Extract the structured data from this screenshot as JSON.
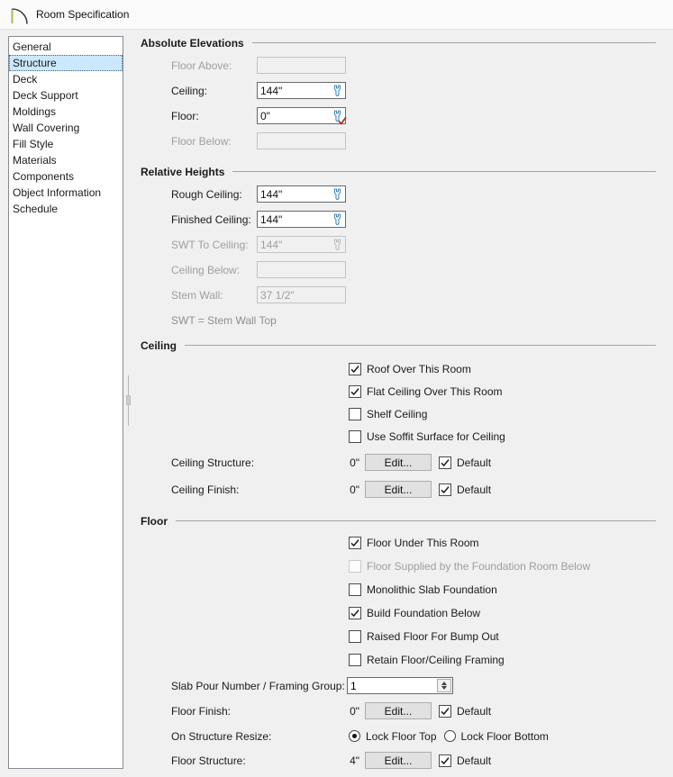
{
  "window": {
    "title": "Room Specification"
  },
  "icons": {
    "title_icon": "room-arc-icon",
    "wrench_icon": "wrench-icon",
    "modified_icon": "red-check-icon",
    "stepper_icon": "up-down-arrow-icons"
  },
  "colors": {
    "selection_bg": "#cce8ff",
    "wrench_blue": "#2f7cb5",
    "modified_red": "#b02f23",
    "panel_bg": "#f0f0f0",
    "button_bg": "#e1e1e1"
  },
  "sidebar": {
    "items": [
      {
        "label": "General",
        "selected": false
      },
      {
        "label": "Structure",
        "selected": true
      },
      {
        "label": "Deck",
        "selected": false
      },
      {
        "label": "Deck Support",
        "selected": false
      },
      {
        "label": "Moldings",
        "selected": false
      },
      {
        "label": "Wall Covering",
        "selected": false
      },
      {
        "label": "Fill Style",
        "selected": false
      },
      {
        "label": "Materials",
        "selected": false
      },
      {
        "label": "Components",
        "selected": false
      },
      {
        "label": "Object Information",
        "selected": false
      },
      {
        "label": "Schedule",
        "selected": false
      }
    ]
  },
  "sections": {
    "absolute_elevations": {
      "title": "Absolute Elevations",
      "rows": [
        {
          "label": "Floor Above:",
          "value": "",
          "disabled": true,
          "wrench": false,
          "modified": false
        },
        {
          "label": "Ceiling:",
          "value": "144\"",
          "disabled": false,
          "wrench": true,
          "modified": false
        },
        {
          "label": "Floor:",
          "value": "0\"",
          "disabled": false,
          "wrench": true,
          "modified": true
        },
        {
          "label": "Floor Below:",
          "value": "",
          "disabled": true,
          "wrench": false,
          "modified": false
        }
      ]
    },
    "relative_heights": {
      "title": "Relative Heights",
      "rows": [
        {
          "label": "Rough Ceiling:",
          "value": "144\"",
          "disabled": false,
          "wrench": true
        },
        {
          "label": "Finished Ceiling:",
          "value": "144\"",
          "disabled": false,
          "wrench": true
        },
        {
          "label": "SWT To Ceiling:",
          "value": "144\"",
          "disabled": true,
          "wrench": true
        },
        {
          "label": "Ceiling Below:",
          "value": "",
          "disabled": true,
          "wrench": false
        },
        {
          "label": "Stem Wall:",
          "value": "37 1/2\"",
          "disabled": true,
          "wrench": false
        }
      ],
      "note": "SWT = Stem Wall Top"
    },
    "ceiling": {
      "title": "Ceiling",
      "checkboxes": [
        {
          "label": "Roof Over This Room",
          "checked": true,
          "disabled": false
        },
        {
          "label": "Flat Ceiling Over This Room",
          "checked": true,
          "disabled": false
        },
        {
          "label": "Shelf Ceiling",
          "checked": false,
          "disabled": false
        },
        {
          "label": "Use Soffit Surface for Ceiling",
          "checked": false,
          "disabled": false
        }
      ],
      "edit_rows": [
        {
          "label": "Ceiling Structure:",
          "value": "0\"",
          "button_label": "Edit...",
          "default_label": "Default",
          "default_checked": true
        },
        {
          "label": "Ceiling Finish:",
          "value": "0\"",
          "button_label": "Edit...",
          "default_label": "Default",
          "default_checked": true
        }
      ]
    },
    "floor": {
      "title": "Floor",
      "checkboxes": [
        {
          "label": "Floor Under This Room",
          "checked": true,
          "disabled": false
        },
        {
          "label": "Floor Supplied by the Foundation Room Below",
          "checked": false,
          "disabled": true
        },
        {
          "label": "Monolithic Slab Foundation",
          "checked": false,
          "disabled": false
        },
        {
          "label": "Build Foundation Below",
          "checked": true,
          "disabled": false
        },
        {
          "label": "Raised Floor For Bump Out",
          "checked": false,
          "disabled": false
        },
        {
          "label": "Retain Floor/Ceiling Framing",
          "checked": false,
          "disabled": false
        }
      ],
      "slab_row": {
        "label": "Slab Pour Number / Framing Group:",
        "value": "1"
      },
      "finish_row": {
        "label": "Floor Finish:",
        "value": "0\"",
        "button_label": "Edit...",
        "default_label": "Default",
        "default_checked": true
      },
      "resize_row": {
        "label": "On Structure Resize:",
        "options": [
          {
            "label": "Lock Floor Top",
            "selected": true
          },
          {
            "label": "Lock Floor Bottom",
            "selected": false
          }
        ]
      },
      "structure_row": {
        "label": "Floor Structure:",
        "value": "4\"",
        "button_label": "Edit...",
        "default_label": "Default",
        "default_checked": true
      }
    }
  }
}
